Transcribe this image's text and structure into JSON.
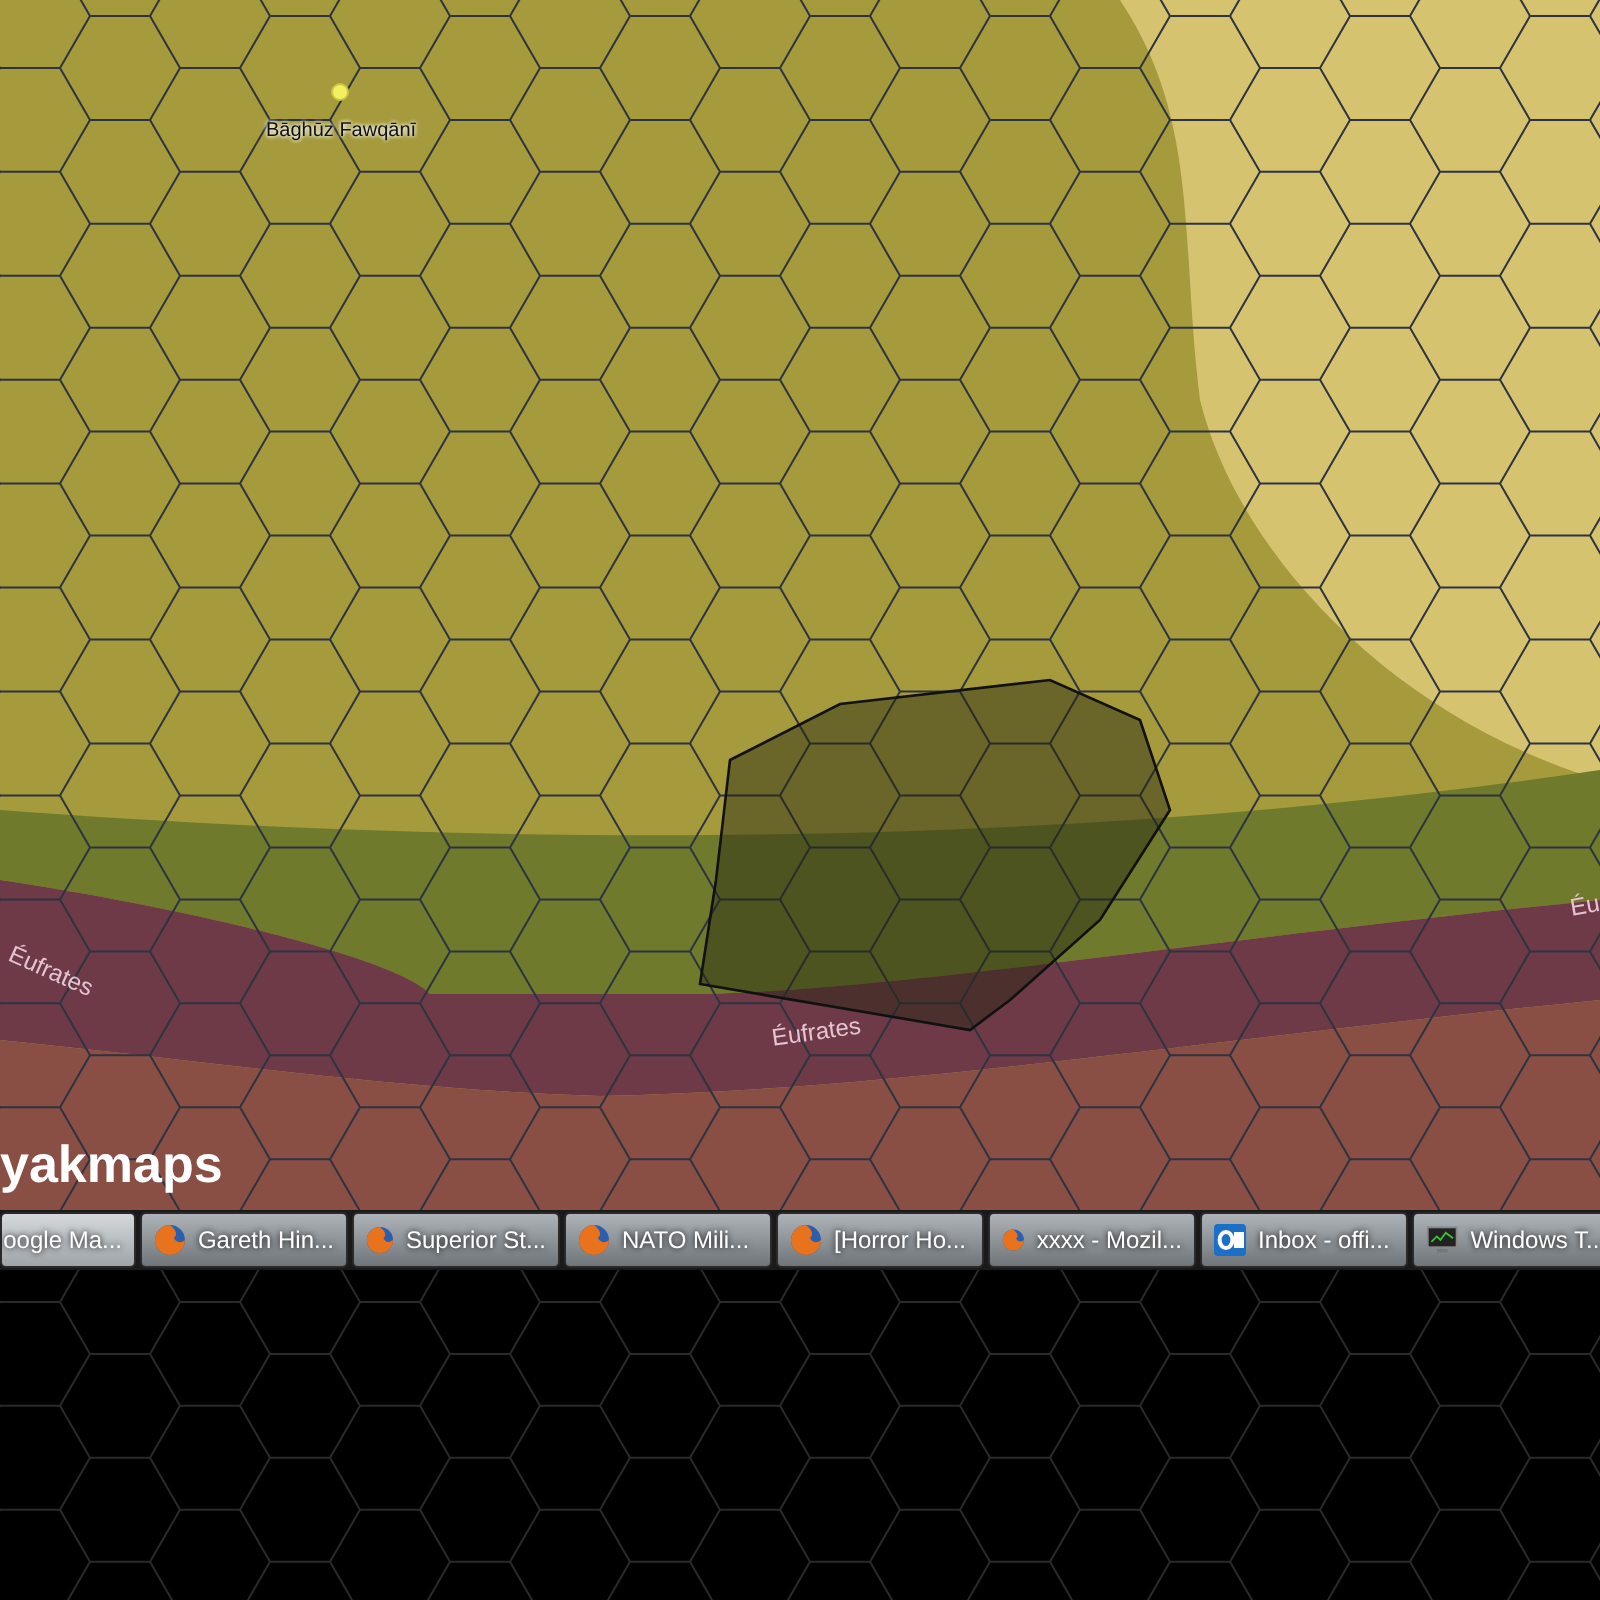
{
  "map": {
    "place_labels": [
      {
        "text": "Bāghūz Fawqānī",
        "kind": "town"
      },
      {
        "text": "Éufrates",
        "kind": "river"
      },
      {
        "text": "Éufrates",
        "kind": "river"
      },
      {
        "text": "Éu",
        "kind": "river"
      }
    ],
    "logo_text": "yakmaps"
  },
  "taskbar": {
    "items": [
      {
        "label": "oogle Ma...",
        "kind": "none",
        "selected": true
      },
      {
        "label": "Gareth Hin...",
        "kind": "browser",
        "selected": false
      },
      {
        "label": "Superior St...",
        "kind": "browser",
        "selected": false
      },
      {
        "label": "NATO Mili...",
        "kind": "browser",
        "selected": false
      },
      {
        "label": "[Horror Ho...",
        "kind": "browser",
        "selected": false
      },
      {
        "label": "xxxx - Mozil...",
        "kind": "browser",
        "selected": false
      },
      {
        "label": "Inbox - offi...",
        "kind": "mail",
        "selected": false
      },
      {
        "label": "Windows T...",
        "kind": "monitor",
        "selected": false
      }
    ]
  }
}
